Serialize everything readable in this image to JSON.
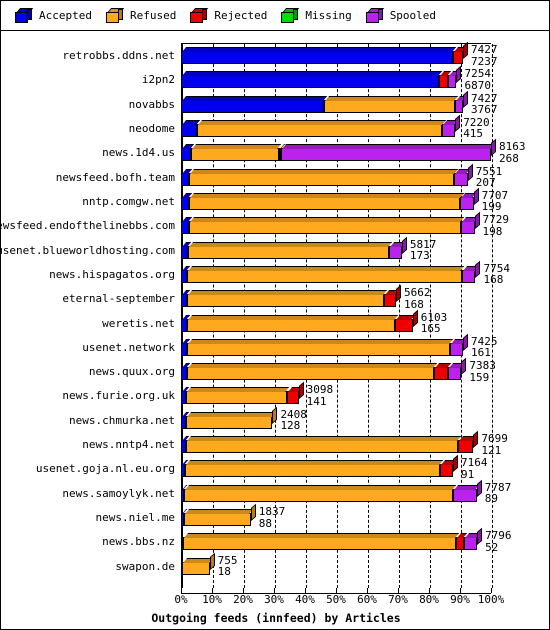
{
  "legend": {
    "items": [
      {
        "label": "Accepted",
        "color": "#0000EE",
        "icon": "cube-icon"
      },
      {
        "label": "Refused",
        "color": "#FFAA1E",
        "icon": "cube-icon"
      },
      {
        "label": "Rejected",
        "color": "#EE0000",
        "icon": "cube-icon"
      },
      {
        "label": "Missing",
        "color": "#00DD00",
        "icon": "cube-icon"
      },
      {
        "label": "Spooled",
        "color": "#BB22EE",
        "icon": "cube-icon"
      }
    ]
  },
  "axis": {
    "x_ticks": [
      "0%",
      "10%",
      "20%",
      "30%",
      "40%",
      "50%",
      "60%",
      "70%",
      "80%",
      "90%",
      "100%"
    ],
    "title": "Outgoing feeds (innfeed) by Articles"
  },
  "chart_data": {
    "type": "bar",
    "orientation": "horizontal",
    "stacked": true,
    "title": "Outgoing feeds (innfeed) by Articles",
    "xlabel": "Outgoing feeds (innfeed) by Articles",
    "ylabel": "",
    "xlim": [
      0,
      100
    ],
    "xunit": "percent",
    "grid": true,
    "legend_position": "top",
    "max_total": 8163,
    "series_names": [
      "Accepted",
      "Refused",
      "Rejected",
      "Missing",
      "Spooled"
    ],
    "series_colors": [
      "#0000EE",
      "#FFAA1E",
      "#EE0000",
      "#00DD00",
      "#BB22EE"
    ],
    "categories": [
      "retrobbs.ddns.net",
      "i2pn2",
      "novabbs",
      "neodome",
      "news.1d4.us",
      "newsfeed.bofh.team",
      "nntp.comgw.net",
      "newsfeed.endofthelinebbs.com",
      "usenet.blueworldhosting.com",
      "news.hispagatos.org",
      "eternal-september",
      "weretis.net",
      "usenet.network",
      "news.quux.org",
      "news.furie.org.uk",
      "news.chmurka.net",
      "news.nntp4.net",
      "usenet.goja.nl.eu.org",
      "news.samoylyk.net",
      "news.niel.me",
      "news.bbs.nz",
      "swapon.de"
    ],
    "rows": [
      {
        "name": "retrobbs.ddns.net",
        "total": 7427,
        "second": 7237,
        "segments": [
          {
            "series": "Accepted",
            "pct": 96.5
          },
          {
            "series": "Rejected",
            "pct": 3.5
          }
        ]
      },
      {
        "name": "i2pn2",
        "total": 7254,
        "second": 6870,
        "segments": [
          {
            "series": "Accepted",
            "pct": 93.8
          },
          {
            "series": "Rejected",
            "pct": 3.3
          },
          {
            "series": "Spooled",
            "pct": 2.9
          }
        ]
      },
      {
        "name": "novabbs",
        "total": 7427,
        "second": 3767,
        "segments": [
          {
            "series": "Accepted",
            "pct": 50.8
          },
          {
            "series": "Refused",
            "pct": 46.3
          },
          {
            "series": "Spooled",
            "pct": 2.9
          }
        ]
      },
      {
        "name": "neodome",
        "total": 7220,
        "second": 415,
        "segments": [
          {
            "series": "Accepted",
            "pct": 5.7
          },
          {
            "series": "Refused",
            "pct": 89.6
          },
          {
            "series": "Spooled",
            "pct": 4.7
          }
        ]
      },
      {
        "name": "news.1d4.us",
        "total": 8163,
        "second": 268,
        "segments": [
          {
            "series": "Accepted",
            "pct": 3.3
          },
          {
            "series": "Refused",
            "pct": 28.2
          },
          {
            "series": "Rejected",
            "pct": 0.8
          },
          {
            "series": "Spooled",
            "pct": 67.7
          }
        ]
      },
      {
        "name": "newsfeed.bofh.team",
        "total": 7551,
        "second": 207,
        "segments": [
          {
            "series": "Accepted",
            "pct": 2.7
          },
          {
            "series": "Refused",
            "pct": 92.6
          },
          {
            "series": "Spooled",
            "pct": 4.7
          }
        ]
      },
      {
        "name": "nntp.comgw.net",
        "total": 7707,
        "second": 199,
        "segments": [
          {
            "series": "Accepted",
            "pct": 2.6
          },
          {
            "series": "Refused",
            "pct": 92.8
          },
          {
            "series": "Spooled",
            "pct": 4.6
          }
        ]
      },
      {
        "name": "newsfeed.endofthelinebbs.com",
        "total": 7729,
        "second": 198,
        "segments": [
          {
            "series": "Accepted",
            "pct": 2.6
          },
          {
            "series": "Refused",
            "pct": 92.8
          },
          {
            "series": "Spooled",
            "pct": 4.6
          }
        ]
      },
      {
        "name": "usenet.blueworldhosting.com",
        "total": 5817,
        "second": 173,
        "segments": [
          {
            "series": "Accepted",
            "pct": 3.0
          },
          {
            "series": "Refused",
            "pct": 91.0
          },
          {
            "series": "Spooled",
            "pct": 6.0
          }
        ]
      },
      {
        "name": "news.hispagatos.org",
        "total": 7754,
        "second": 168,
        "segments": [
          {
            "series": "Accepted",
            "pct": 2.2
          },
          {
            "series": "Refused",
            "pct": 93.1
          },
          {
            "series": "Spooled",
            "pct": 4.7
          }
        ]
      },
      {
        "name": "eternal-september",
        "total": 5662,
        "second": 168,
        "segments": [
          {
            "series": "Accepted",
            "pct": 3.0
          },
          {
            "series": "Refused",
            "pct": 91.5
          },
          {
            "series": "Rejected",
            "pct": 5.5
          }
        ]
      },
      {
        "name": "weretis.net",
        "total": 6103,
        "second": 165,
        "segments": [
          {
            "series": "Accepted",
            "pct": 2.7
          },
          {
            "series": "Refused",
            "pct": 89.8
          },
          {
            "series": "Rejected",
            "pct": 7.5
          }
        ]
      },
      {
        "name": "usenet.network",
        "total": 7425,
        "second": 161,
        "segments": [
          {
            "series": "Accepted",
            "pct": 2.2
          },
          {
            "series": "Refused",
            "pct": 93.1
          },
          {
            "series": "Spooled",
            "pct": 4.7
          }
        ]
      },
      {
        "name": "news.quux.org",
        "total": 7383,
        "second": 159,
        "segments": [
          {
            "series": "Accepted",
            "pct": 2.2
          },
          {
            "series": "Refused",
            "pct": 88.0
          },
          {
            "series": "Rejected",
            "pct": 5.1
          },
          {
            "series": "Spooled",
            "pct": 4.7
          }
        ]
      },
      {
        "name": "news.furie.org.uk",
        "total": 3098,
        "second": 141,
        "segments": [
          {
            "series": "Accepted",
            "pct": 4.6
          },
          {
            "series": "Refused",
            "pct": 85.4
          },
          {
            "series": "Rejected",
            "pct": 10.0
          }
        ]
      },
      {
        "name": "news.chmurka.net",
        "total": 2408,
        "second": 128,
        "segments": [
          {
            "series": "Accepted",
            "pct": 5.3
          },
          {
            "series": "Refused",
            "pct": 94.7
          }
        ]
      },
      {
        "name": "news.nntp4.net",
        "total": 7699,
        "second": 121,
        "segments": [
          {
            "series": "Accepted",
            "pct": 1.6
          },
          {
            "series": "Refused",
            "pct": 93.0
          },
          {
            "series": "Rejected",
            "pct": 5.4
          }
        ]
      },
      {
        "name": "usenet.goja.nl.eu.org",
        "total": 7164,
        "second": 91,
        "segments": [
          {
            "series": "Accepted",
            "pct": 1.3
          },
          {
            "series": "Refused",
            "pct": 93.8
          },
          {
            "series": "Rejected",
            "pct": 4.9
          }
        ]
      },
      {
        "name": "news.samoylyk.net",
        "total": 7787,
        "second": 89,
        "segments": [
          {
            "series": "Accepted",
            "pct": 1.1
          },
          {
            "series": "Refused",
            "pct": 91.0
          },
          {
            "series": "Spooled",
            "pct": 7.9
          }
        ]
      },
      {
        "name": "news.niel.me",
        "total": 1837,
        "second": 88,
        "segments": [
          {
            "series": "Accepted",
            "pct": 4.8
          },
          {
            "series": "Refused",
            "pct": 95.2
          }
        ]
      },
      {
        "name": "news.bbs.nz",
        "total": 7796,
        "second": 52,
        "segments": [
          {
            "series": "Accepted",
            "pct": 0.7
          },
          {
            "series": "Refused",
            "pct": 92.2
          },
          {
            "series": "Rejected",
            "pct": 2.6
          },
          {
            "series": "Spooled",
            "pct": 4.5
          }
        ]
      },
      {
        "name": "swapon.de",
        "total": 755,
        "second": 18,
        "segments": [
          {
            "series": "Accepted",
            "pct": 2.4
          },
          {
            "series": "Refused",
            "pct": 97.6
          }
        ]
      }
    ]
  }
}
